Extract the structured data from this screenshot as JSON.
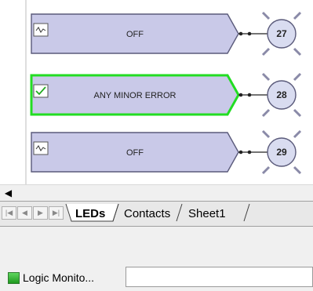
{
  "leds": [
    {
      "label": "OFF",
      "number": "27",
      "state": "off"
    },
    {
      "label": "ANY MINOR ERROR",
      "number": "28",
      "state": "on"
    },
    {
      "label": "OFF",
      "number": "29",
      "state": "off"
    }
  ],
  "sheet_tabs": [
    "LEDs",
    "Contacts",
    "Sheet1"
  ],
  "active_tab": "LEDs",
  "taskbar": {
    "app_label": "Logic Monito..."
  },
  "colors": {
    "led_fill": "#c9c9e8",
    "led_border": "#5a5a7a",
    "active_outline": "#22dd22",
    "bulb_fill": "#d9dcf0",
    "ray": "#8a8aa8"
  }
}
